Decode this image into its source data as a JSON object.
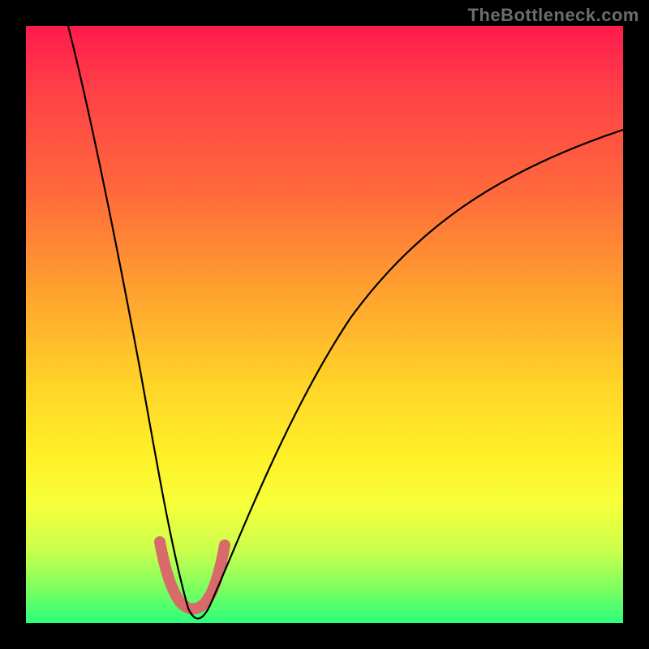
{
  "watermark": "TheBottleneck.com",
  "chart_data": {
    "type": "line",
    "title": "",
    "xlabel": "",
    "ylabel": "",
    "xlim": [
      0,
      100
    ],
    "ylim": [
      0,
      100
    ],
    "series": [
      {
        "name": "bottleneck-curve",
        "x": [
          7,
          10,
          13,
          16,
          19,
          21,
          23,
          25,
          27,
          29,
          31,
          40,
          50,
          60,
          70,
          80,
          90,
          100
        ],
        "y": [
          100,
          80,
          62,
          46,
          32,
          22,
          13,
          7,
          3,
          1,
          3,
          20,
          40,
          55,
          66,
          74,
          80,
          83
        ]
      },
      {
        "name": "highlight-band",
        "x": [
          23,
          24,
          25,
          26,
          27,
          28,
          29,
          30,
          31,
          32
        ],
        "y": [
          12,
          8,
          5,
          3,
          2,
          2,
          3,
          5,
          8,
          12
        ]
      }
    ]
  },
  "colors": {
    "curve": "#000000",
    "highlight": "#d96a6a",
    "gradient_top": "#ff1a4d",
    "gradient_bottom": "#2cff7a"
  }
}
